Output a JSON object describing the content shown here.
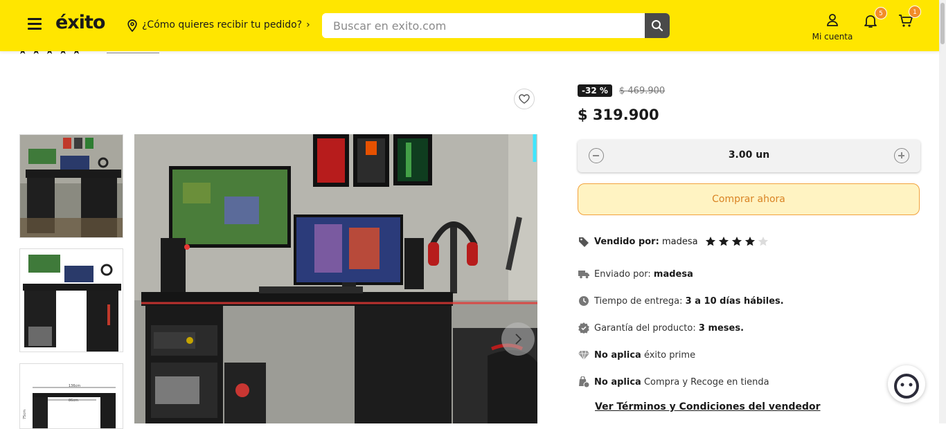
{
  "header": {
    "logo_text": "éxito",
    "delivery_prompt": "¿Cómo quieres recibir tu pedido?",
    "search_placeholder": "Buscar en exito.com",
    "account_label": "Mi cuenta",
    "notifications_count": "5",
    "cart_count": "1",
    "bg_color": "#ffe600"
  },
  "peek": {
    "rating_stars": "★★★★★"
  },
  "product": {
    "discount": "-32 %",
    "old_price": "$ 469.900",
    "price": "$ 319.900",
    "quantity": "3.00 un",
    "buy_label": "Comprar ahora"
  },
  "seller": {
    "sold_by_label": "Vendido por:",
    "sold_by_value": "madesa",
    "rating": 4,
    "rating_max": 5,
    "shipped_by_label": "Enviado por:",
    "shipped_by_value": "madesa",
    "delivery_label": "Tiempo de entrega:",
    "delivery_value": "3 a 10 días hábiles.",
    "warranty_label": "Garantía del producto:",
    "warranty_value": "3 meses.",
    "prime_strong": "No aplica",
    "prime_text": "éxito prime",
    "pickup_strong": "No aplica",
    "pickup_text": "Compra y Recoge en tienda",
    "terms_link": "Ver Términos y Condiciones del vendedor"
  },
  "gallery": {
    "thumb_dims_top": "136cm",
    "thumb_dims_inner": "86cm",
    "thumb_dims_side": "75cm"
  }
}
